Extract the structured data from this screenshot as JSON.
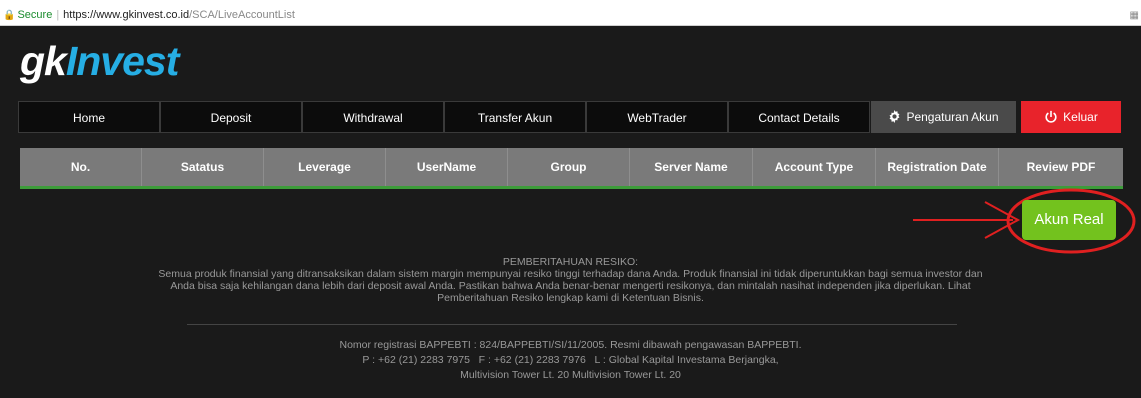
{
  "browser": {
    "secure_label": "Secure",
    "url_host": "https://www.gkinvest.co.id",
    "url_path": "/SCA/LiveAccountList"
  },
  "brand": {
    "logo_prefix": "gk",
    "logo_suffix": "Invest",
    "accent_color": "#26aee4"
  },
  "nav": {
    "items": [
      "Home",
      "Deposit",
      "Withdrawal",
      "Transfer Akun",
      "WebTrader",
      "Contact Details"
    ],
    "settings_label": "Pengaturan Akun",
    "logout_label": "Keluar"
  },
  "table": {
    "columns": [
      "No.",
      "Satatus",
      "Leverage",
      "UserName",
      "Group",
      "Server Name",
      "Account Type",
      "Registration Date",
      "Review PDF"
    ]
  },
  "actions": {
    "akun_real_label": "Akun Real"
  },
  "notice": {
    "title": "PEMBERITAHUAN RESIKO:",
    "line1": "Semua produk finansial yang ditransaksikan dalam sistem margin mempunyai resiko tinggi terhadap dana Anda. Produk finansial ini tidak diperuntukkan bagi semua investor dan",
    "line2": "Anda bisa saja kehilangan dana lebih dari deposit awal Anda. Pastikan bahwa Anda benar-benar mengerti resikonya, dan mintalah nasihat independen jika diperlukan. Lihat",
    "line3": "Pemberitahuan Resiko lengkap kami di Ketentuan Bisnis."
  },
  "footer": {
    "line1": "Nomor registrasi BAPPEBTI : 824/BAPPEBTI/SI/11/2005. Resmi dibawah pengawasan BAPPEBTI.",
    "line2": "P : +62 (21) 2283 7975   F : +62 (21) 2283 7976   L : Global Kapital Investama Berjangka,",
    "line3": "Multivision Tower Lt. 20 Multivision Tower Lt. 20"
  }
}
